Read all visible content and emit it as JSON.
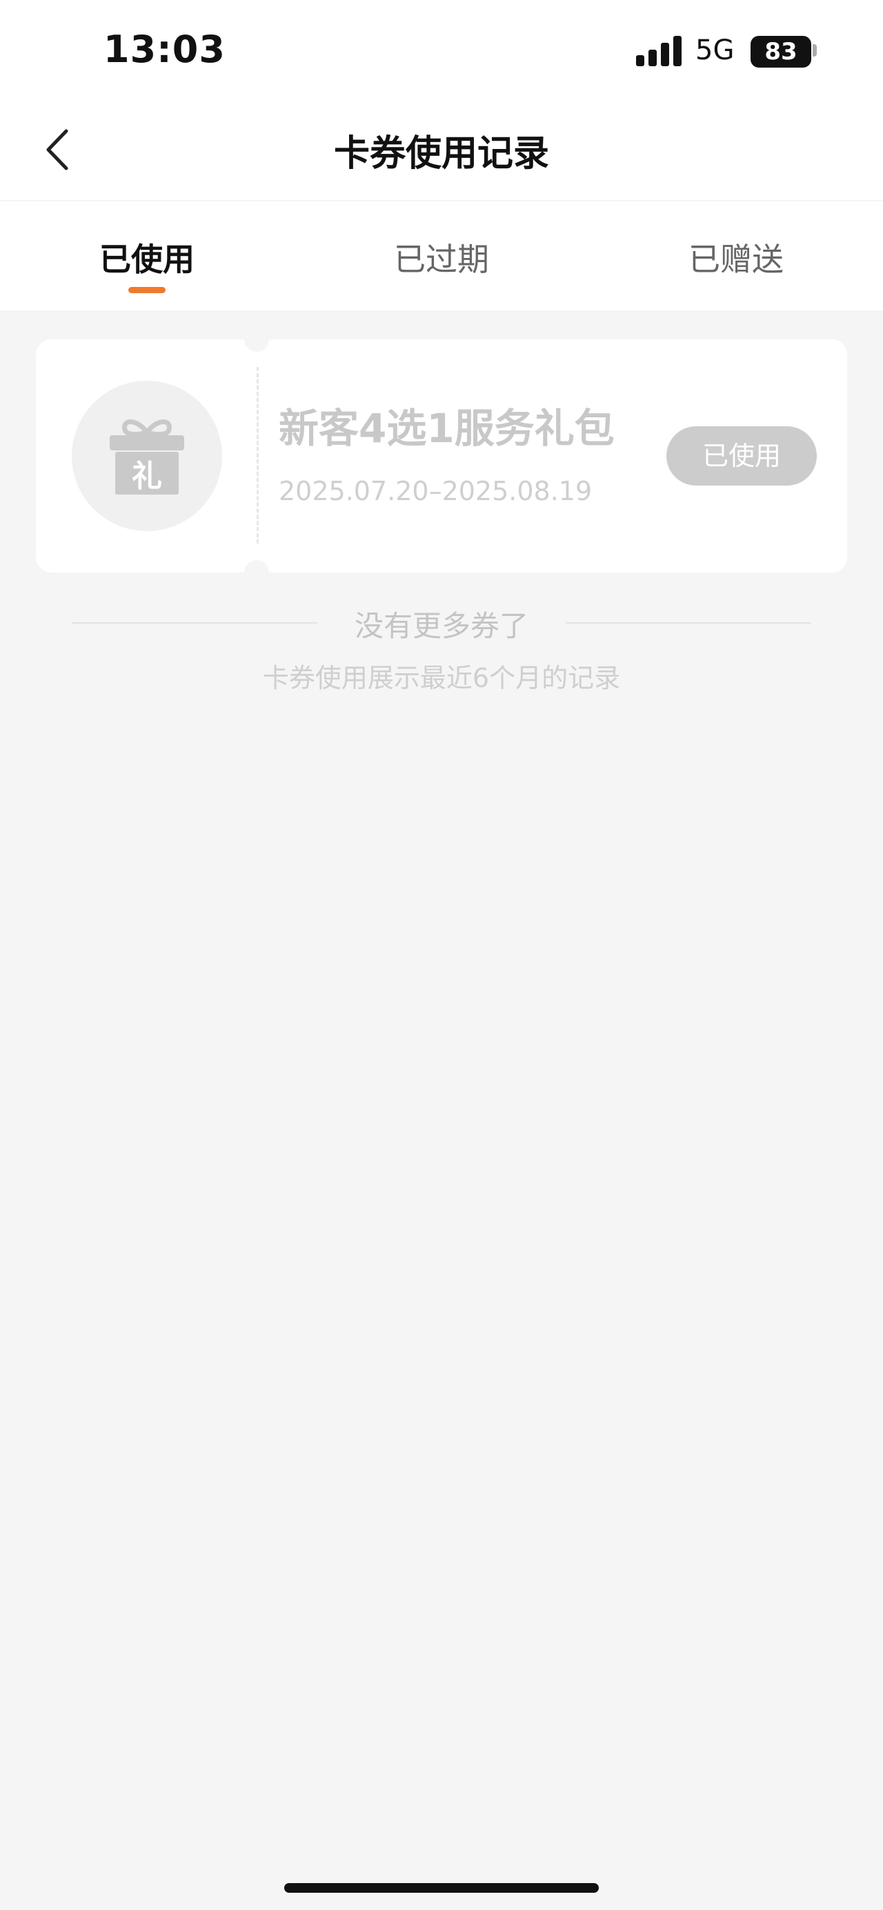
{
  "status_bar": {
    "time": "13:03",
    "network": "5G",
    "battery": "83"
  },
  "header": {
    "title": "卡券使用记录"
  },
  "tabs": [
    {
      "label": "已使用",
      "active": true
    },
    {
      "label": "已过期",
      "active": false
    },
    {
      "label": "已赠送",
      "active": false
    }
  ],
  "coupons": [
    {
      "icon": "gift-icon",
      "icon_text": "礼",
      "title": "新客4选1服务礼包",
      "date_range": "2025.07.20–2025.08.19",
      "status": "已使用"
    }
  ],
  "footer": {
    "no_more": "没有更多券了",
    "note": "卡券使用展示最近6个月的记录"
  },
  "colors": {
    "accent": "#f07a2c",
    "background": "#f5f5f5",
    "badge_gray": "#cccccc"
  }
}
